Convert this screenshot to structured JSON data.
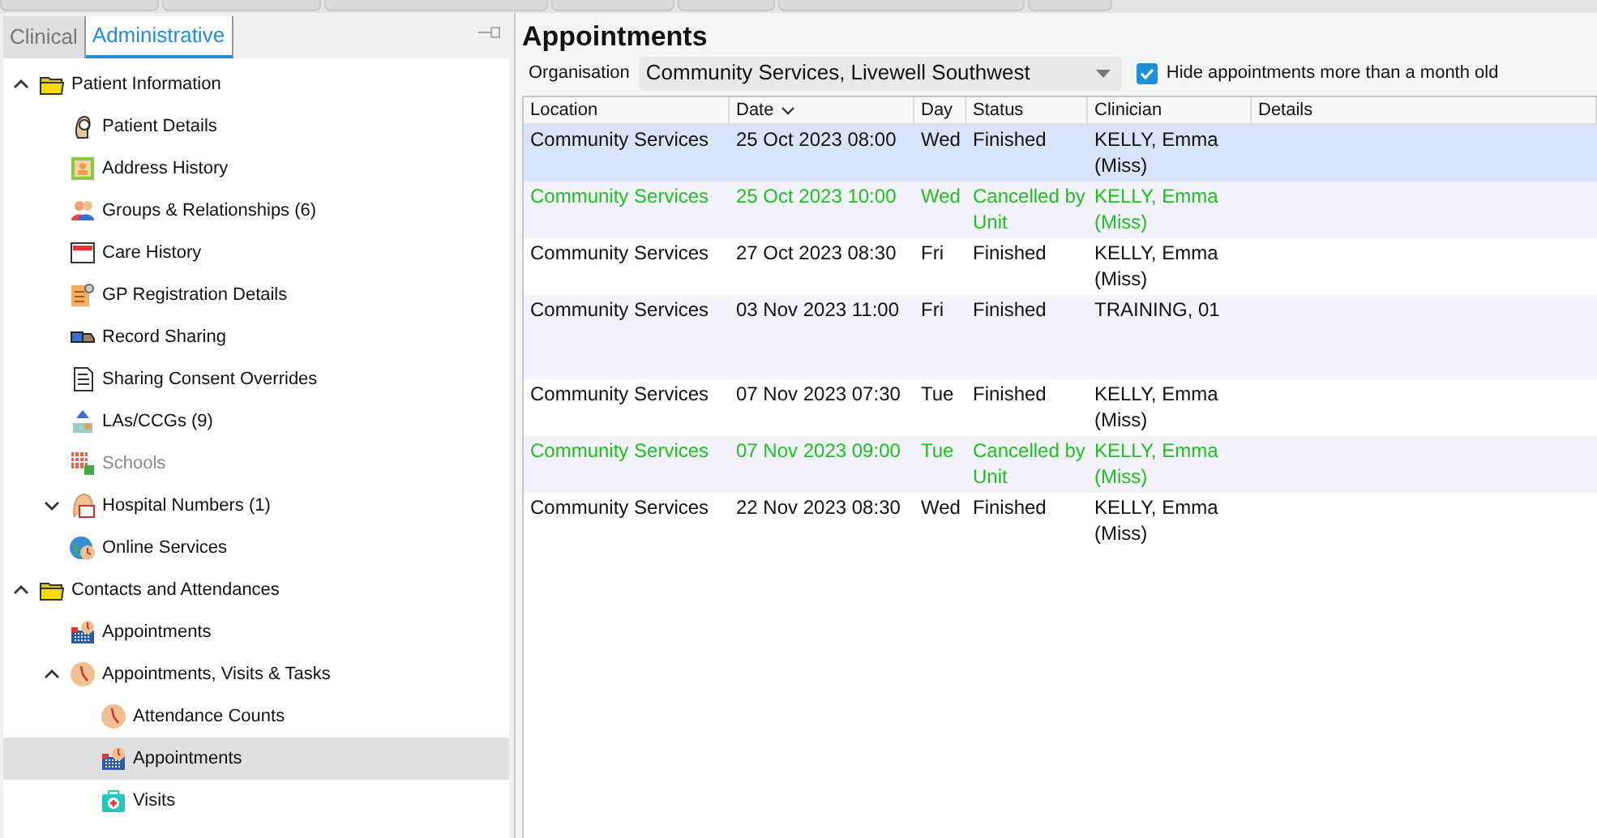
{
  "top_tabs": [
    {
      "selected": false
    },
    {
      "selected": false
    },
    {
      "selected": false
    },
    {
      "selected": false
    },
    {
      "selected": false
    },
    {
      "selected": false
    },
    {
      "selected": false
    }
  ],
  "sidebar": {
    "tabs": [
      {
        "label": "Clinical",
        "selected": false
      },
      {
        "label": "Administrative",
        "selected": true
      }
    ],
    "tree": [
      {
        "label": "Patient Information",
        "expanded": true,
        "children": [
          {
            "label": "Patient Details"
          },
          {
            "label": "Address History"
          },
          {
            "label": "Groups & Relationships (6)"
          },
          {
            "label": "Care History"
          },
          {
            "label": "GP Registration Details"
          },
          {
            "label": "Record Sharing"
          },
          {
            "label": "Sharing Consent Overrides"
          },
          {
            "label": "LAs/CCGs (9)"
          },
          {
            "label": "Schools",
            "disabled": true
          },
          {
            "label": "Hospital Numbers (1)",
            "expanded": false
          },
          {
            "label": "Online Services"
          }
        ]
      },
      {
        "label": "Contacts and Attendances",
        "expanded": true,
        "children": [
          {
            "label": "Appointments"
          },
          {
            "label": "Appointments, Visits & Tasks",
            "expanded": true,
            "children": [
              {
                "label": "Attendance Counts"
              },
              {
                "label": "Appointments",
                "selected": true
              },
              {
                "label": "Visits"
              }
            ]
          }
        ]
      }
    ]
  },
  "main": {
    "title": "Appointments",
    "organisation_label": "Organisation",
    "organisation": "Community Services, Livewell Southwest",
    "hide_old": {
      "label": "Hide appointments more than a month old",
      "checked": true
    },
    "table": {
      "columns": [
        {
          "label": "Location"
        },
        {
          "label": "Date",
          "sorted": true
        },
        {
          "label": "Day"
        },
        {
          "label": "Status"
        },
        {
          "label": "Clinician"
        },
        {
          "label": "Details"
        }
      ],
      "rows": [
        {
          "cells": [
            "Community Services",
            "25 Oct 2023 08:00",
            "Wed",
            "Finished",
            "KELLY, Emma (Miss)"
          ],
          "selected": true,
          "cancelled": false
        },
        {
          "cells": [
            "Community Services",
            "25 Oct 2023 10:00",
            "Wed",
            "Cancelled by Unit",
            "KELLY, Emma (Miss)"
          ],
          "selected": false,
          "cancelled": true
        },
        {
          "cells": [
            "Community Services",
            "27 Oct 2023 08:30",
            "Fri",
            "Finished",
            "KELLY, Emma (Miss)"
          ],
          "selected": false,
          "cancelled": false
        },
        {
          "cells": [
            "Community Services",
            "03 Nov 2023 11:00",
            "Fri",
            "Finished",
            "TRAINING, 01"
          ],
          "selected": false,
          "cancelled": false,
          "tall": true
        },
        {
          "cells": [
            "Community Services",
            "07 Nov 2023 07:30",
            "Tue",
            "Finished",
            "KELLY, Emma (Miss)"
          ],
          "selected": false,
          "cancelled": false
        },
        {
          "cells": [
            "Community Services",
            "07 Nov 2023 09:00",
            "Tue",
            "Cancelled by Unit",
            "KELLY, Emma (Miss)"
          ],
          "selected": false,
          "cancelled": true
        },
        {
          "cells": [
            "Community Services",
            "22 Nov 2023 08:30",
            "Wed",
            "Finished",
            "KELLY, Emma (Miss)"
          ],
          "selected": false,
          "cancelled": false
        }
      ]
    }
  }
}
